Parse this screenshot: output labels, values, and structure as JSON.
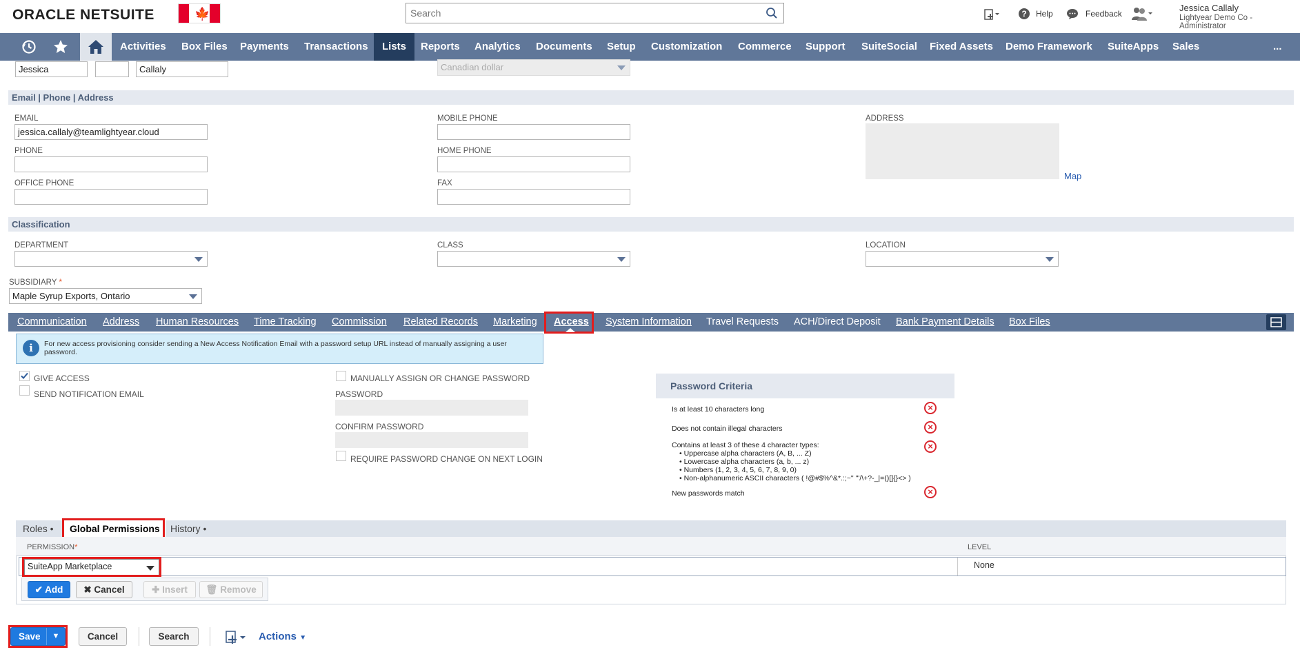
{
  "header": {
    "logo_oracle": "ORACLE",
    "logo_netsuite": "NETSUITE",
    "search_placeholder": "Search",
    "help": "Help",
    "feedback": "Feedback",
    "user_name": "Jessica Callaly",
    "user_role": "Lightyear Demo Co - Administrator"
  },
  "nav": {
    "items": [
      "Activities",
      "Box Files",
      "Payments",
      "Transactions",
      "Lists",
      "Reports",
      "Analytics",
      "Documents",
      "Setup",
      "Customization",
      "Commerce",
      "Support",
      "SuiteSocial",
      "Fixed Assets",
      "Demo Framework",
      "SuiteApps",
      "Sales"
    ],
    "active": "Lists",
    "more": "..."
  },
  "name": {
    "first": "Jessica",
    "middle": "",
    "last": "Callaly",
    "currency": "Canadian dollar"
  },
  "contact": {
    "section_title": "Email | Phone | Address",
    "email_label": "EMAIL",
    "email_value": "jessica.callaly@teamlightyear.cloud",
    "phone_label": "PHONE",
    "office_phone_label": "OFFICE PHONE",
    "mobile_phone_label": "MOBILE PHONE",
    "home_phone_label": "HOME PHONE",
    "fax_label": "FAX",
    "address_label": "ADDRESS",
    "map_link": "Map"
  },
  "classification": {
    "section_title": "Classification",
    "department_label": "DEPARTMENT",
    "class_label": "CLASS",
    "location_label": "LOCATION",
    "subsidiary_label": "SUBSIDIARY",
    "required_mark": "*",
    "subsidiary_value": "Maple Syrup Exports, Ontario"
  },
  "subtabs": {
    "items": [
      "Communication",
      "Address",
      "Human Resources",
      "Time Tracking",
      "Commission",
      "Related Records",
      "Marketing",
      "Access",
      "System Information",
      "Travel Requests",
      "ACH/Direct Deposit",
      "Bank Payment Details",
      "Box Files"
    ],
    "active": "Access"
  },
  "access": {
    "info_text": "For new access provisioning consider sending a New Access Notification Email with a password setup URL instead of manually assigning a user password.",
    "give_access": "GIVE ACCESS",
    "give_access_checked": true,
    "send_notification": "SEND NOTIFICATION EMAIL",
    "manually_assign": "MANUALLY ASSIGN OR CHANGE PASSWORD",
    "password_label": "PASSWORD",
    "confirm_password_label": "CONFIRM PASSWORD",
    "require_change": "REQUIRE PASSWORD CHANGE ON NEXT LOGIN"
  },
  "password_criteria": {
    "title": "Password Criteria",
    "rule1": "Is at least 10 characters long",
    "rule2": "Does not contain illegal characters",
    "rule3": "Contains at least 3 of these 4 character types:",
    "rule3_sub": [
      "• Uppercase alpha characters (A, B, ... Z)",
      "• Lowercase alpha characters (a, b, ... z)",
      "• Numbers (1, 2, 3, 4, 5, 6, 7, 8, 9, 0)",
      "• Non-alphanumeric ASCII characters ( !@#$%^&*.:;~\" '\"/\\+?-_|=()[]{}<> )"
    ],
    "rule4": "New passwords match"
  },
  "lower_tabs": {
    "roles": "Roles •",
    "global_permissions": "Global Permissions",
    "history": "History •"
  },
  "permissions_grid": {
    "col_permission": "PERMISSION",
    "required_mark": "*",
    "col_level": "LEVEL",
    "row_permission": "SuiteApp Marketplace",
    "row_level": "None",
    "add": "Add",
    "cancel": "Cancel",
    "insert": "Insert",
    "remove": "Remove"
  },
  "footer": {
    "save": "Save",
    "cancel": "Cancel",
    "search": "Search",
    "actions": "Actions"
  },
  "colors": {
    "nav": "#607799",
    "nav_active": "#243d5e",
    "highlight": "#e21d1d",
    "primary_button": "#1f7ae0"
  }
}
